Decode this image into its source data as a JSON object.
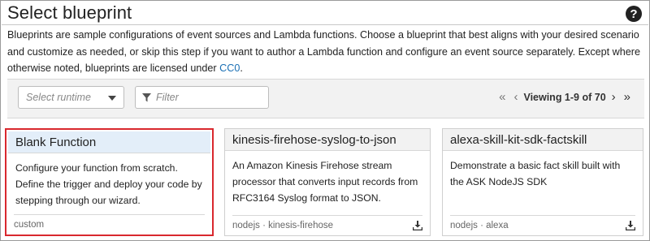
{
  "header": {
    "title": "Select blueprint",
    "help_icon": "?"
  },
  "description": {
    "text": "Blueprints are sample configurations of event sources and Lambda functions. Choose a blueprint that best aligns with your desired scenario and customize as needed, or skip this step if you want to author a Lambda function and configure an event source separately. Except where otherwise noted, blueprints are licensed under ",
    "link": "CC0",
    "suffix": "."
  },
  "toolbar": {
    "runtime_placeholder": "Select runtime",
    "filter_placeholder": "Filter",
    "pager": {
      "first": "«",
      "prev": "‹",
      "viewing": "Viewing 1-9 of 70",
      "next": "›",
      "last": "»"
    }
  },
  "cards": [
    {
      "title": "Blank Function",
      "description": "Configure your function from scratch. Define the trigger and deploy your code by stepping through our wizard.",
      "tags": "custom",
      "selected": true
    },
    {
      "title": "kinesis-firehose-syslog-to-json",
      "description": "An Amazon Kinesis Firehose stream processor that converts input records from RFC3164 Syslog format to JSON.",
      "tags": "nodejs · kinesis-firehose",
      "selected": false
    },
    {
      "title": "alexa-skill-kit-sdk-factskill",
      "description": "Demonstrate a basic fact skill built with the ASK NodeJS SDK",
      "tags": "nodejs · alexa",
      "selected": false
    }
  ],
  "colors": {
    "selected_border": "#d9282e",
    "selected_header": "#e3eef9",
    "link": "#1a6fb4"
  }
}
